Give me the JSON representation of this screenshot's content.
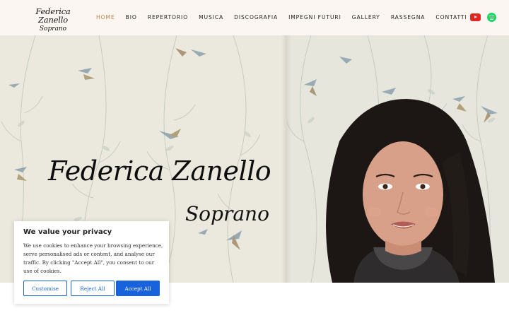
{
  "logo": {
    "name": "Federica Zanello",
    "subtitle": "Soprano"
  },
  "nav": {
    "items": [
      "HOME",
      "BIO",
      "REPERTORIO",
      "MUSICA",
      "DISCOGRAFIA",
      "IMPEGNI FUTURI",
      "GALLERY",
      "RASSEGNA",
      "CONTATTI"
    ],
    "active": "HOME"
  },
  "social": {
    "icons": [
      "youtube-icon",
      "spotify-icon"
    ]
  },
  "hero": {
    "title": "Federica Zanello",
    "subtitle": "Soprano"
  },
  "cookie": {
    "title": "We value your privacy",
    "text": "We use cookies to enhance your browsing experience, serve personalised ads or content, and analyse our traffic. By clicking \"Accept All\", you consent to our use of cookies.",
    "customise": "Customise",
    "reject": "Reject All",
    "accept": "Accept All"
  },
  "colors": {
    "accent": "#b8834a",
    "header_bg": "#fcf6f3",
    "cookie_blue": "#1863dc",
    "youtube": "#e32521",
    "spotify": "#1ed760"
  }
}
